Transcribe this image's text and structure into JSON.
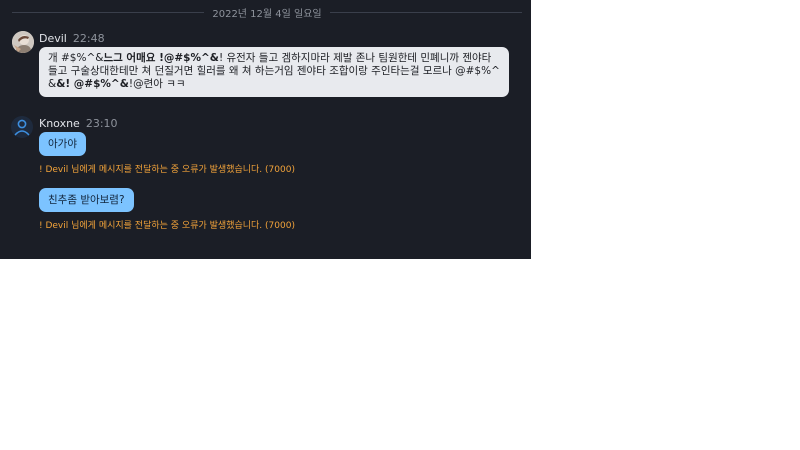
{
  "date_divider": "2022년 12월 4일 일요일",
  "messages": [
    {
      "sender": "Devil",
      "time": "22:48",
      "parts": [
        {
          "text": "개 #$%^&",
          "bold": false
        },
        {
          "text": "느그 어매요 !@#$%^&",
          "bold": true
        },
        {
          "text": "! 유전자 들고 겜하지마라 제발 존나 팀원한테 민폐니까 젠야타들고 구술상대한테만 쳐 던질거면 힐러를 왜 쳐 하는거임 젠야타 조합이랑 주인타는걸 모르나 @#$%^&",
          "bold": false
        },
        {
          "text": "&! @#$%^&",
          "bold": true
        },
        {
          "text": "!@련아 ㅋㅋ",
          "bold": false
        }
      ]
    }
  ],
  "outgoing": {
    "sender": "Knoxne",
    "time": "23:10",
    "items": [
      {
        "text": "아가야",
        "error": "! Devil 님에게 메시지를 전달하는 중 오류가 발생했습니다. (7000)"
      },
      {
        "text": "친추좀 받아보렴?",
        "error": "! Devil 님에게 메시지를 전달하는 중 오류가 발생했습니다. (7000)"
      }
    ]
  },
  "colors": {
    "panel_bg": "#1b1e26",
    "incoming_bubble": "#e8eaee",
    "outgoing_bubble": "#7cc3ff",
    "error_text": "#f2a33a"
  },
  "icons": {
    "devil_avatar": "user-photo-avatar",
    "knoxne_avatar": "default-user-icon"
  }
}
